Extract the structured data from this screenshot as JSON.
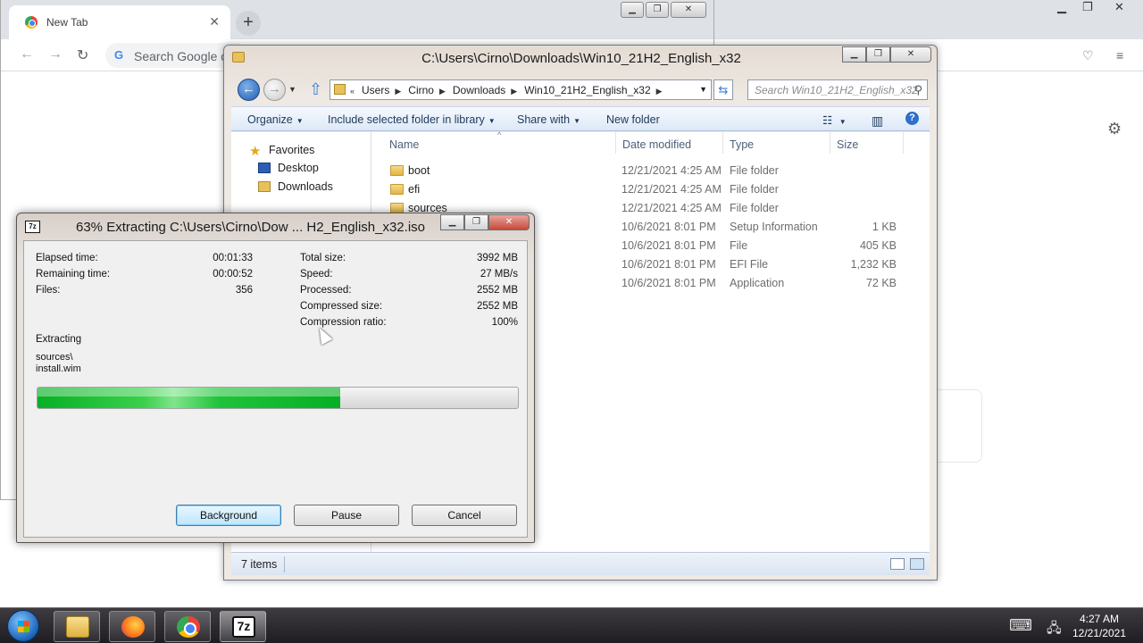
{
  "chrome": {
    "tab_title": "New Tab",
    "search_placeholder": "Search Google or type a URL",
    "search_visible": "Search Google o"
  },
  "explorer": {
    "title": "C:\\Users\\Cirno\\Downloads\\Win10_21H2_English_x32",
    "breadcrumbs": [
      "Users",
      "Cirno",
      "Downloads",
      "Win10_21H2_English_x32"
    ],
    "search_placeholder": "Search Win10_21H2_English_x32",
    "commands": {
      "organize": "Organize",
      "include": "Include selected folder in library",
      "share": "Share with",
      "new_folder": "New folder"
    },
    "nav": {
      "favorites": "Favorites",
      "desktop": "Desktop",
      "downloads": "Downloads"
    },
    "columns": {
      "name": "Name",
      "date": "Date modified",
      "type": "Type",
      "size": "Size"
    },
    "rows": [
      {
        "name": "boot",
        "date": "12/21/2021 4:25 AM",
        "type": "File folder",
        "size": ""
      },
      {
        "name": "efi",
        "date": "12/21/2021 4:25 AM",
        "type": "File folder",
        "size": ""
      },
      {
        "name": "sources",
        "date": "12/21/2021 4:25 AM",
        "type": "File folder",
        "size": ""
      },
      {
        "name": "",
        "date": "10/6/2021 8:01 PM",
        "type": "Setup Information",
        "size": "1 KB"
      },
      {
        "name": "",
        "date": "10/6/2021 8:01 PM",
        "type": "File",
        "size": "405 KB"
      },
      {
        "name": "",
        "date": "10/6/2021 8:01 PM",
        "type": "EFI File",
        "size": "1,232 KB"
      },
      {
        "name": "",
        "date": "10/6/2021 8:01 PM",
        "type": "Application",
        "size": "72 KB"
      }
    ],
    "status": "7 items"
  },
  "zip": {
    "title": "63% Extracting C:\\Users\\Cirno\\Dow ... H2_English_x32.iso",
    "icon_text": "7z",
    "left": [
      {
        "label": "Elapsed time:",
        "value": "00:01:33"
      },
      {
        "label": "Remaining time:",
        "value": "00:00:52"
      },
      {
        "label": "Files:",
        "value": "356"
      }
    ],
    "right": [
      {
        "label": "Total size:",
        "value": "3992 MB"
      },
      {
        "label": "Speed:",
        "value": "27 MB/s"
      },
      {
        "label": "Processed:",
        "value": "2552 MB"
      },
      {
        "label": "Compressed size:",
        "value": "2552 MB"
      },
      {
        "label": "Compression ratio:",
        "value": "100%"
      }
    ],
    "operation": "Extracting",
    "path_line1": "sources\\",
    "path_line2": "install.wim",
    "progress_percent": 63,
    "buttons": {
      "background": "Background",
      "pause": "Pause",
      "cancel": "Cancel"
    }
  },
  "taskbar": {
    "icons": [
      "file-explorer-icon",
      "firefox-icon",
      "chrome-icon",
      "7zip-icon"
    ],
    "time": "4:27 AM",
    "date": "12/21/2021"
  },
  "colors": {
    "progress_green": "#06b025",
    "explorer_link": "#1e395b",
    "close_red": "#c74a3a"
  }
}
